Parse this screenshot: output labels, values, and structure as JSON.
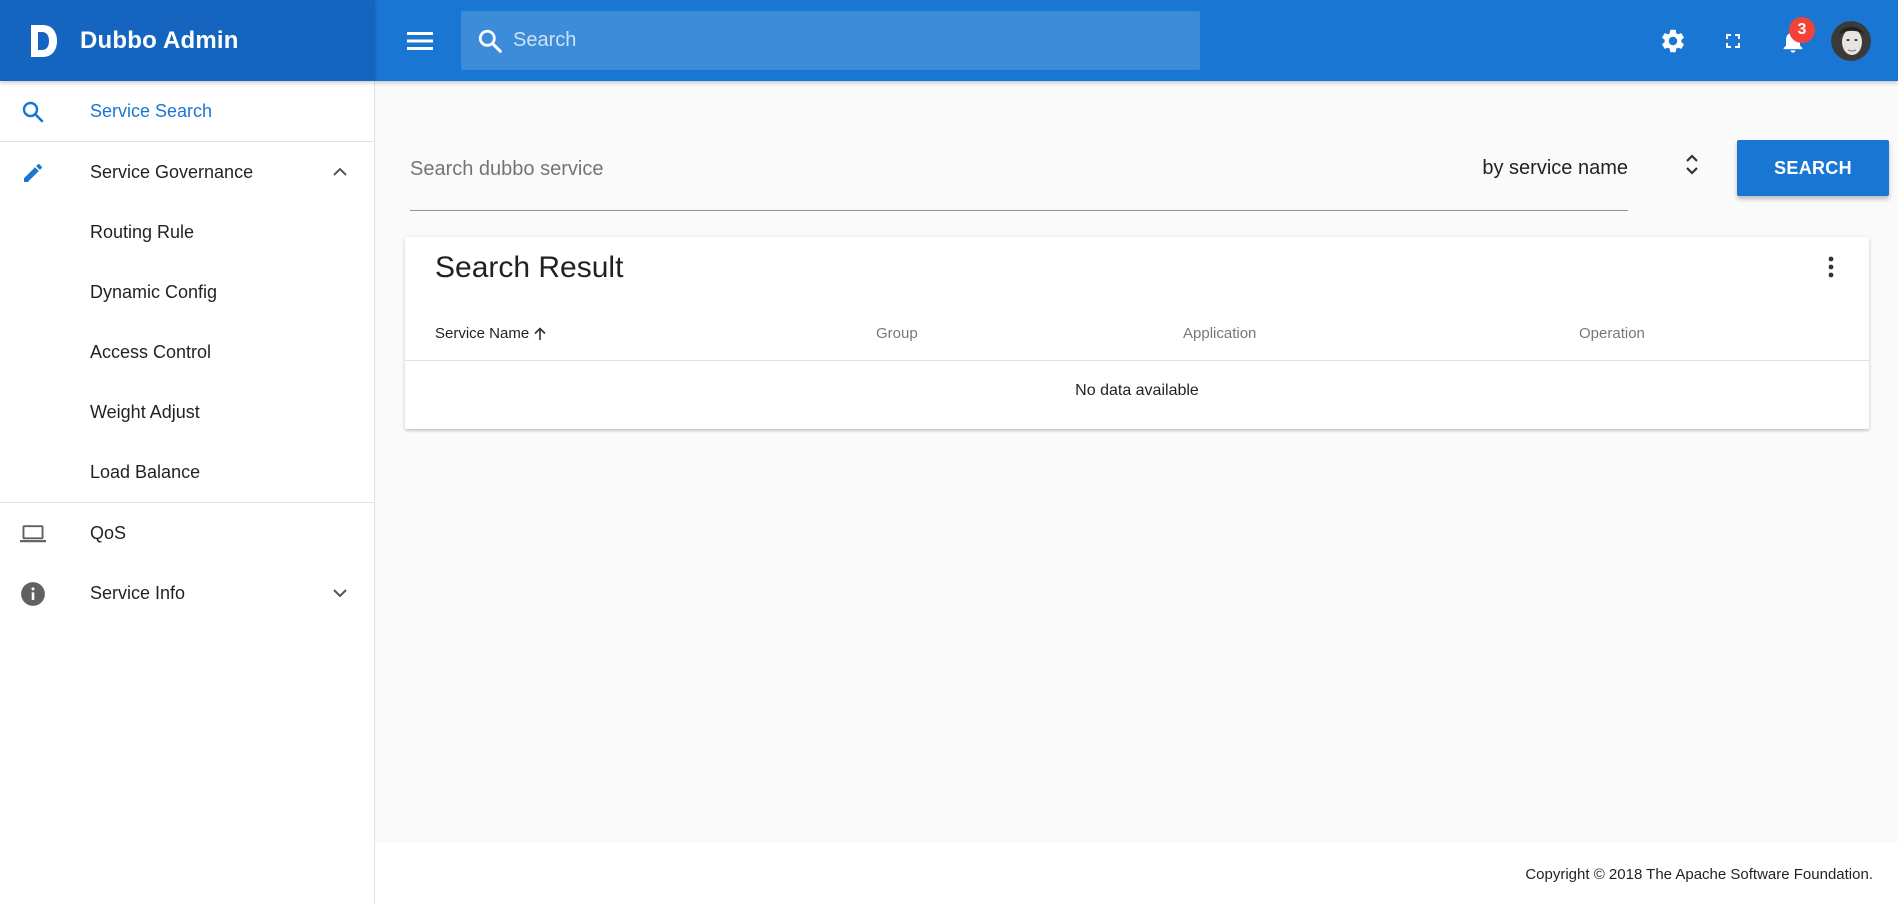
{
  "brand": {
    "title": "Dubbo Admin",
    "logo_letter": "D"
  },
  "topbar": {
    "search_placeholder": "Search",
    "notifications_count": "3"
  },
  "sidebar": {
    "items": [
      {
        "label": "Service Search",
        "icon": "search-icon",
        "active": true
      },
      {
        "label": "Service Governance",
        "icon": "pencil-icon",
        "expanded": true,
        "children": [
          {
            "label": "Routing Rule"
          },
          {
            "label": "Dynamic Config"
          },
          {
            "label": "Access Control"
          },
          {
            "label": "Weight Adjust"
          },
          {
            "label": "Load Balance"
          }
        ]
      },
      {
        "label": "QoS",
        "icon": "laptop-icon"
      },
      {
        "label": "Service Info",
        "icon": "info-icon",
        "expanded": false
      }
    ]
  },
  "search": {
    "placeholder": "Search dubbo service",
    "value": "",
    "select_value": "by service name",
    "button_label": "SEARCH"
  },
  "results": {
    "title": "Search Result",
    "columns": [
      "Service Name",
      "Group",
      "Application",
      "Operation"
    ],
    "sorted_column": "Service Name",
    "empty_text": "No data available"
  },
  "footer": {
    "copyright": "Copyright © 2018 The Apache Software Foundation."
  },
  "colors": {
    "primary": "#1976d2",
    "primary_dark": "#1565c0",
    "badge": "#f44336"
  }
}
